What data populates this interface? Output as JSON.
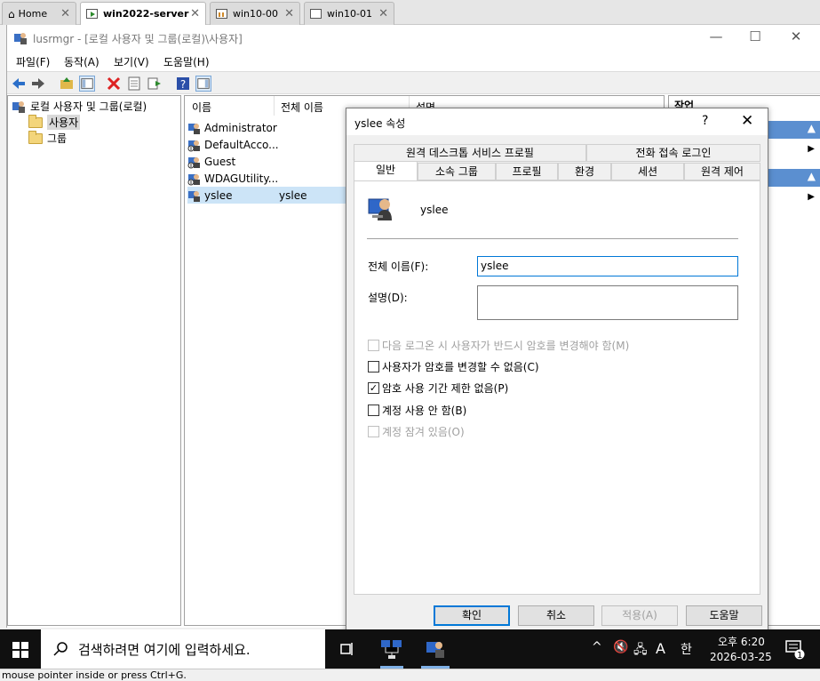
{
  "vm_tabs": [
    {
      "label": "Home",
      "active": false
    },
    {
      "label": "win2022-server",
      "active": true
    },
    {
      "label": "win10-00",
      "active": false
    },
    {
      "label": "win10-01",
      "active": false
    }
  ],
  "window": {
    "title": "lusrmgr - [로컬 사용자 및 그룹(로컬)\\사용자]",
    "minimize": "—",
    "maximize": "☐",
    "close": "✕"
  },
  "menubar": [
    "파일(F)",
    "동작(A)",
    "보기(V)",
    "도움말(H)"
  ],
  "toolbar": [
    "back-icon",
    "forward-icon",
    "up-folder-icon",
    "show-hide-tree-icon",
    "delete-icon",
    "properties-icon",
    "export-icon",
    "help-icon",
    "show-hide-action-icon"
  ],
  "tree": {
    "root": "로컬 사용자 및 그룹(로컬)",
    "children": [
      "사용자",
      "그룹"
    ],
    "selected": "사용자"
  },
  "list": {
    "columns": [
      "이름",
      "전체 이름",
      "설명"
    ],
    "rows": [
      {
        "name": "Administrator",
        "full_name": ""
      },
      {
        "name": "DefaultAcco...",
        "full_name": ""
      },
      {
        "name": "Guest",
        "full_name": ""
      },
      {
        "name": "WDAGUtility...",
        "full_name": ""
      },
      {
        "name": "yslee",
        "full_name": "yslee"
      }
    ],
    "selected_row": "yslee"
  },
  "actions": {
    "header": "작업"
  },
  "dialog": {
    "title": "yslee 속성",
    "help": "?",
    "close": "✕",
    "tabs_row1": [
      "원격 데스크톱 서비스 프로필",
      "전화 접속 로그인"
    ],
    "tabs_row2": [
      "일반",
      "소속 그룹",
      "프로필",
      "환경",
      "세션",
      "원격 제어"
    ],
    "active_tab": "일반",
    "username": "yslee",
    "full_name_label": "전체 이름(F):",
    "full_name_value": "yslee",
    "description_label": "설명(D):",
    "description_value": "",
    "checkboxes": [
      {
        "label": "다음 로그온 시 사용자가 반드시 암호를 변경해야 함(M)",
        "checked": false,
        "disabled": true
      },
      {
        "label": "사용자가 암호를 변경할 수 없음(C)",
        "checked": false,
        "disabled": false
      },
      {
        "label": "암호 사용 기간 제한 없음(P)",
        "checked": true,
        "disabled": false
      },
      {
        "label": "계정 사용 안 함(B)",
        "checked": false,
        "disabled": false
      },
      {
        "label": "계정 잠겨 있음(O)",
        "checked": false,
        "disabled": true
      }
    ],
    "buttons": {
      "ok": "확인",
      "cancel": "취소",
      "apply": "적용(A)",
      "help": "도움말"
    }
  },
  "taskbar": {
    "search_placeholder": "검색하려면 여기에 입력하세요.",
    "time": "오후 6:20",
    "date": "2026-03-25",
    "ime": "A",
    "ime_lang": "한",
    "notification_count": "1"
  },
  "status_line": "mouse pointer inside or press Ctrl+G.",
  "colors": {
    "accent": "#0078d7",
    "taskbar": "#101010",
    "action_header": "#5b8fd0"
  }
}
